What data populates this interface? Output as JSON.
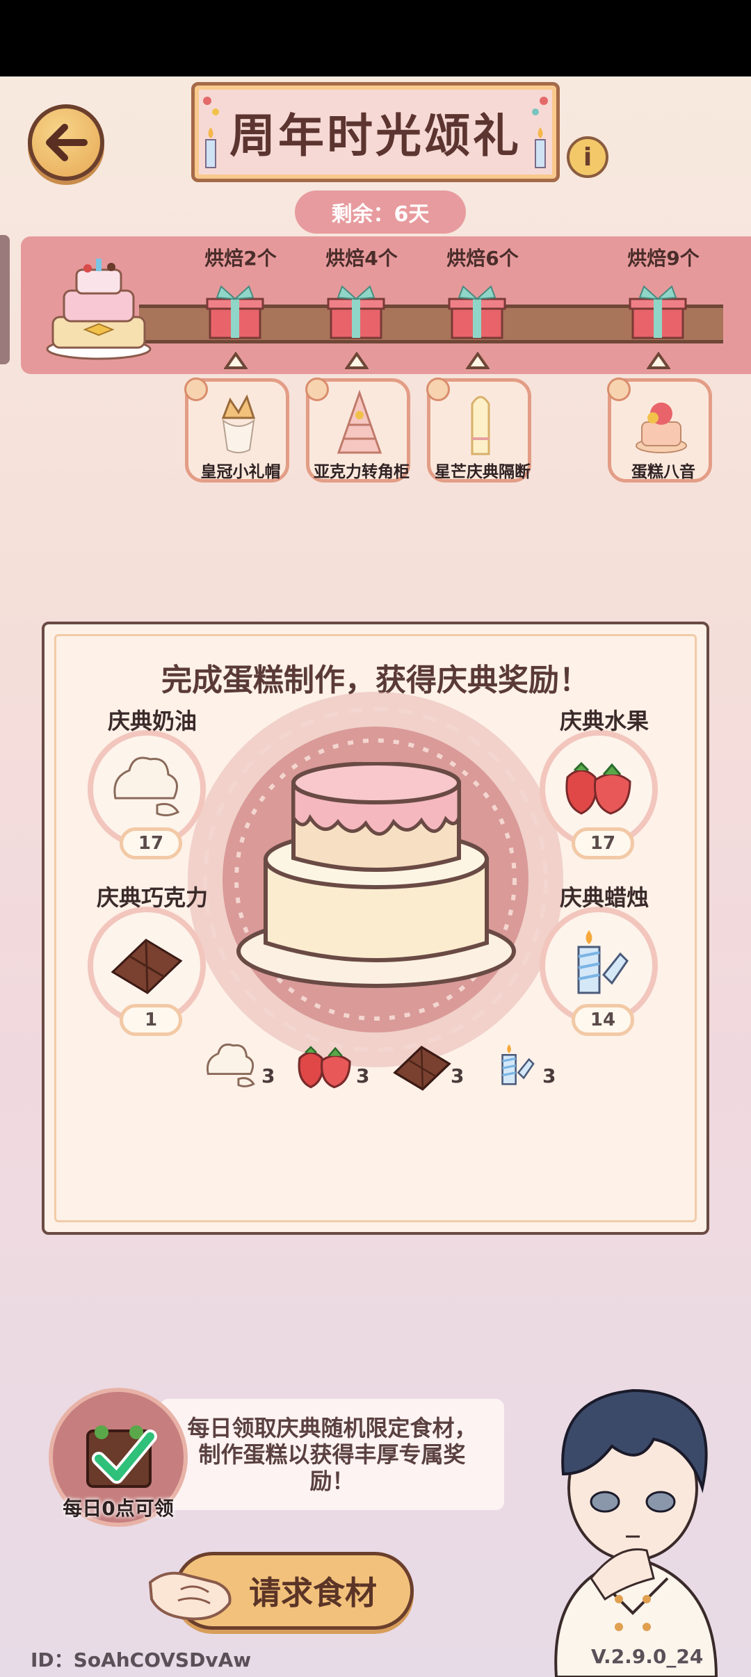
{
  "header": {
    "title": "周年时光颂礼",
    "info_glyph": "i",
    "remaining": "剩余：6天"
  },
  "milestones": [
    {
      "label": "烘焙2个",
      "reward": "皇冠小礼帽"
    },
    {
      "label": "烘焙4个",
      "reward": "亚克力转角柜"
    },
    {
      "label": "烘焙6个",
      "reward": "星芒庆典隔断"
    },
    {
      "label": "烘焙9个",
      "reward": "蛋糕八音"
    }
  ],
  "panel": {
    "title": "完成蛋糕制作，获得庆典奖励！",
    "ingredients": [
      {
        "name": "庆典奶油",
        "count": "17",
        "icon": "cream-icon"
      },
      {
        "name": "庆典水果",
        "count": "17",
        "icon": "strawberry-icon"
      },
      {
        "name": "庆典巧克力",
        "count": "1",
        "icon": "chocolate-icon"
      },
      {
        "name": "庆典蜡烛",
        "count": "14",
        "icon": "candle-icon"
      }
    ],
    "requirements": [
      {
        "icon": "cream-icon",
        "count": "3"
      },
      {
        "icon": "strawberry-icon",
        "count": "3"
      },
      {
        "icon": "chocolate-icon",
        "count": "3"
      },
      {
        "icon": "candle-icon",
        "count": "3"
      }
    ]
  },
  "tip": {
    "avatar_label": "每日0点可领",
    "text": "每日领取庆典随机限定食材，制作蛋糕以获得丰厚专属奖励！"
  },
  "request_button": "请求食材",
  "footer": {
    "id": "ID：SoAhCOVSDvAw",
    "version": "V.2.9.0_24"
  },
  "colors": {
    "band": "#e6999b",
    "button": "#f2c27c",
    "border_dark": "#6b3f2c"
  }
}
